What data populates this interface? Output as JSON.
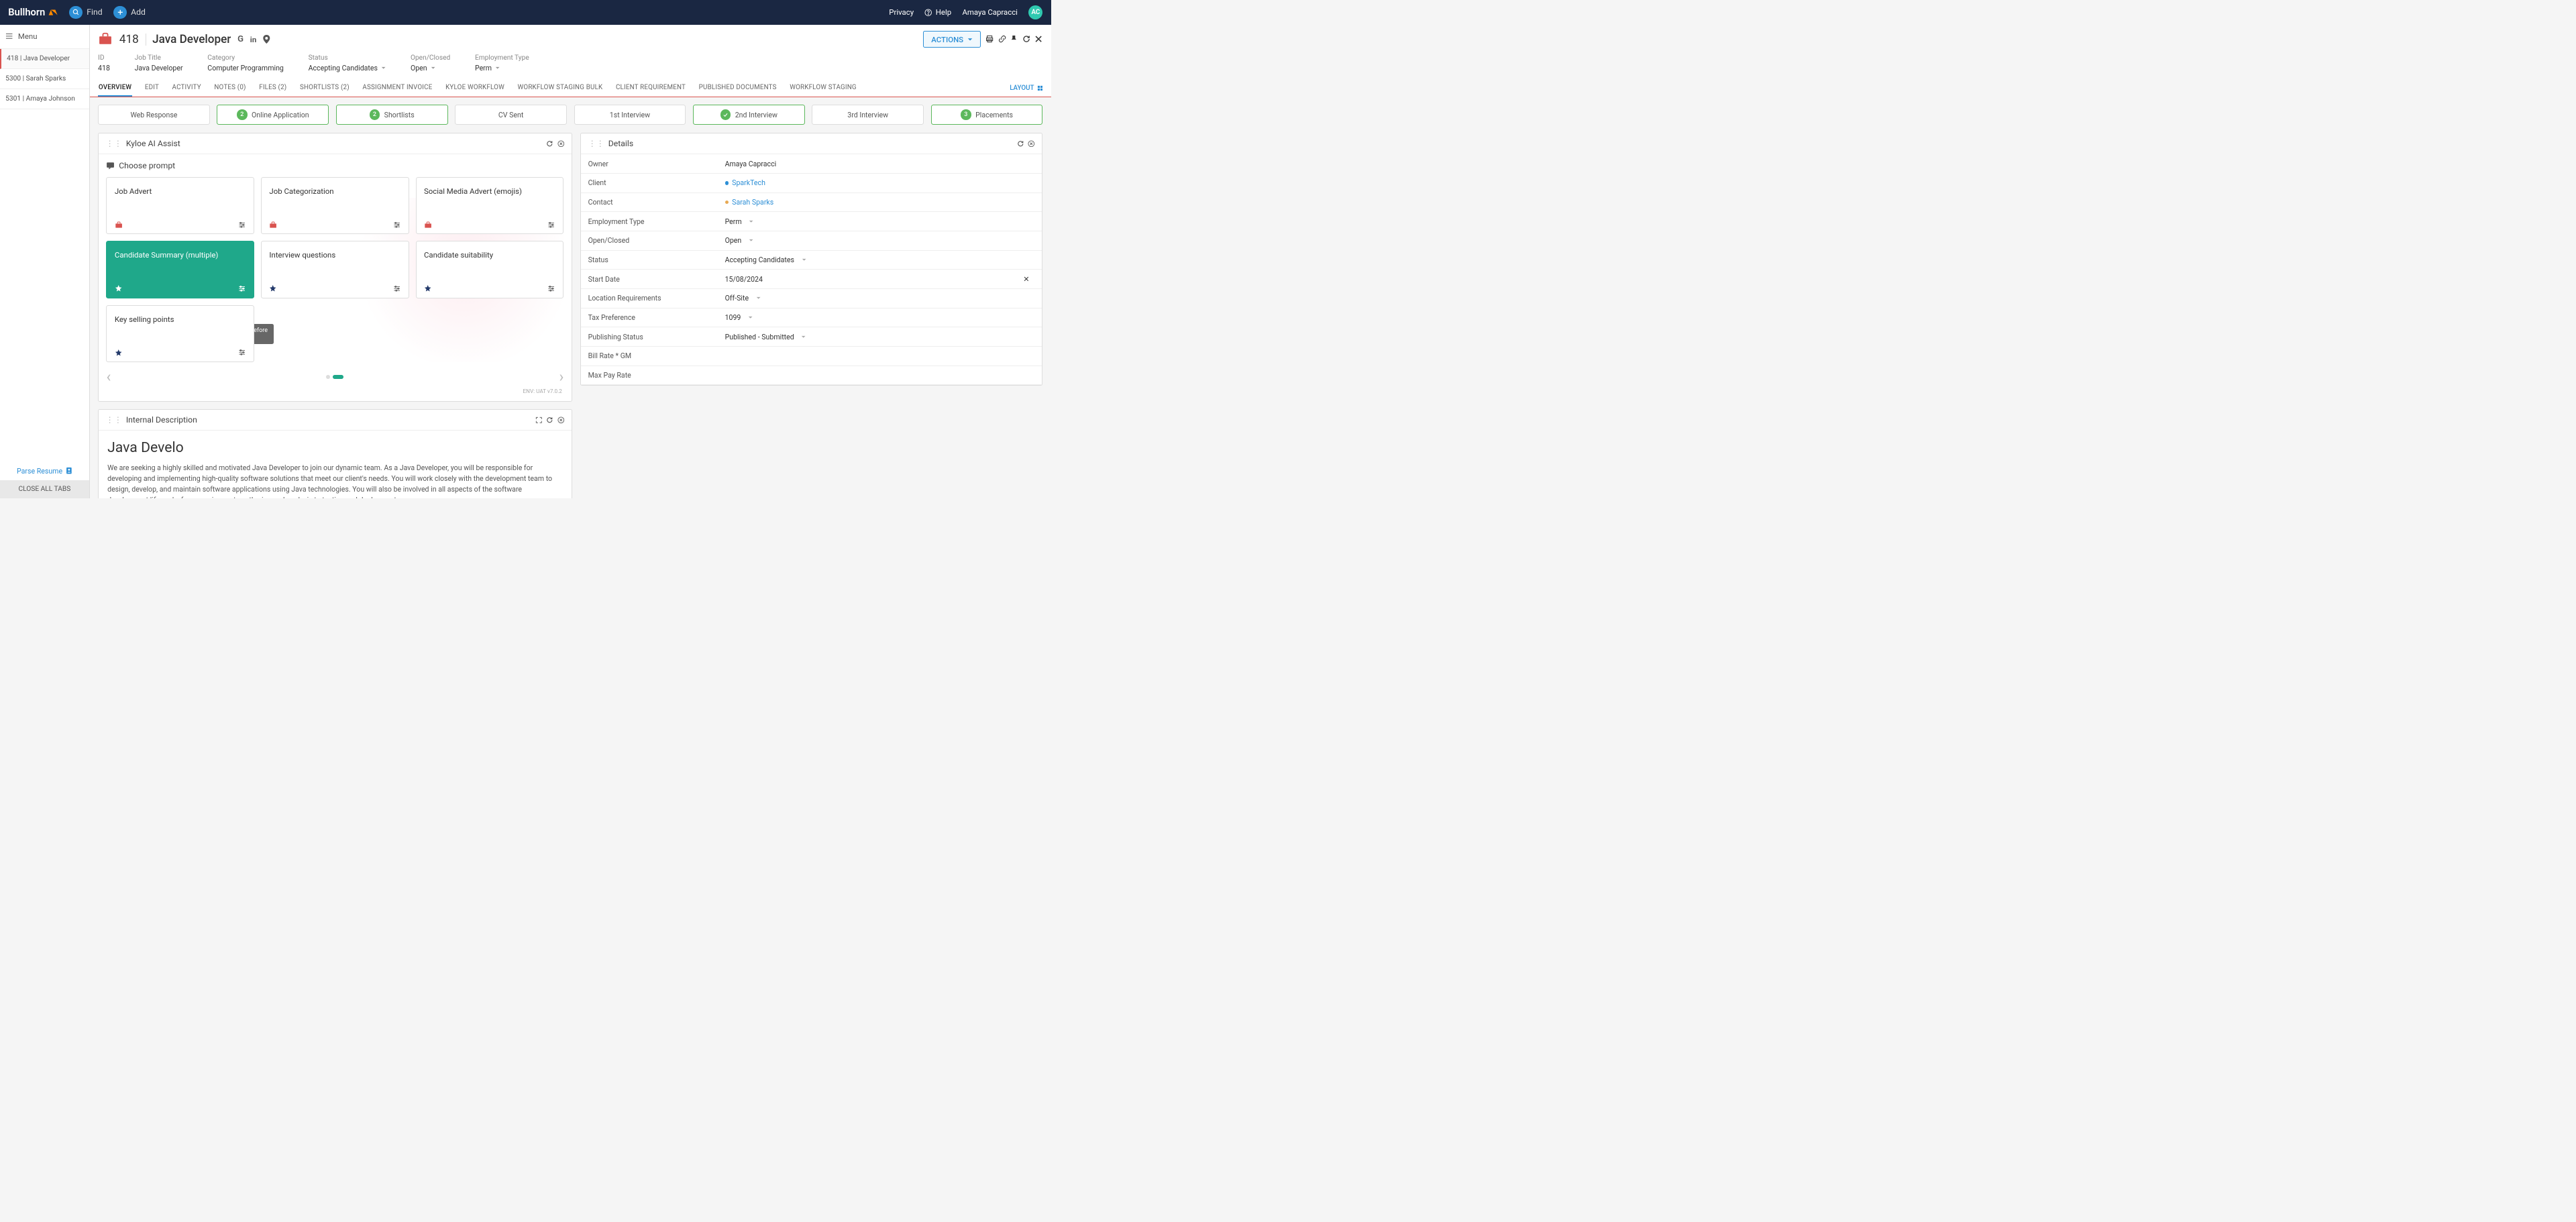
{
  "topnav": {
    "logo": "Bullhorn",
    "find": "Find",
    "add": "Add",
    "privacy": "Privacy",
    "help": "Help",
    "user": "Amaya Capracci",
    "avatar_initials": "AC"
  },
  "sidebar": {
    "menu": "Menu",
    "tabs": [
      {
        "label": "418 | Java Developer",
        "active": true
      },
      {
        "label": "5300 | Sarah Sparks",
        "active": false
      },
      {
        "label": "5301 | Amaya Johnson",
        "active": false
      }
    ],
    "parse": "Parse Resume",
    "close_all": "CLOSE ALL TABS"
  },
  "record": {
    "id": "418",
    "title": "Java Developer",
    "actions_btn": "ACTIONS",
    "fields": [
      {
        "label": "ID",
        "value": "418"
      },
      {
        "label": "Job Title",
        "value": "Java Developer"
      },
      {
        "label": "Category",
        "value": "Computer Programming"
      },
      {
        "label": "Status",
        "value": "Accepting Candidates",
        "dropdown": true
      },
      {
        "label": "Open/Closed",
        "value": "Open",
        "dropdown": true
      },
      {
        "label": "Employment Type",
        "value": "Perm",
        "dropdown": true
      }
    ],
    "tabs": [
      "OVERVIEW",
      "EDIT",
      "ACTIVITY",
      "NOTES (0)",
      "FILES (2)",
      "SHORTLISTS (2)",
      "ASSIGNMENT INVOICE",
      "KYLOE WORKFLOW",
      "WORKFLOW STAGING BULK",
      "CLIENT REQUIREMENT",
      "PUBLISHED DOCUMENTS",
      "WORKFLOW STAGING"
    ],
    "active_tab": "OVERVIEW",
    "layout": "LAYOUT"
  },
  "stages": [
    {
      "label": "Web Response",
      "count": null,
      "style": "plain"
    },
    {
      "label": "Online Application",
      "count": "2",
      "style": "green"
    },
    {
      "label": "Shortlists",
      "count": "2",
      "style": "green"
    },
    {
      "label": "CV Sent",
      "count": null,
      "style": "plain"
    },
    {
      "label": "1st Interview",
      "count": null,
      "style": "plain"
    },
    {
      "label": "2nd Interview",
      "count": null,
      "style": "green-check"
    },
    {
      "label": "3rd Interview",
      "count": null,
      "style": "plain"
    },
    {
      "label": "Placements",
      "count": "3",
      "style": "green"
    }
  ],
  "kyloe": {
    "title": "Kyloe AI Assist",
    "choose_prompt": "Choose prompt",
    "cards": [
      {
        "title": "Job Advert",
        "icon": "briefcase"
      },
      {
        "title": "Job Categorization",
        "icon": "briefcase"
      },
      {
        "title": "Social Media Advert (emojis)",
        "icon": "briefcase"
      },
      {
        "title": "Candidate Summary (multiple)",
        "icon": "star",
        "selected": true
      },
      {
        "title": "Interview questions",
        "icon": "star"
      },
      {
        "title": "Candidate suitability",
        "icon": "star"
      },
      {
        "title": "Key selling points",
        "icon": "star"
      }
    ],
    "tooltip": "Configure prompt before running",
    "env": "ENV: UAT v7.0.2"
  },
  "description": {
    "panel_title": "Internal Description",
    "heading": "Java Develo",
    "body": "We are seeking a highly skilled and motivated Java Developer to join our dynamic team. As a Java Developer, you will be responsible for developing and implementing high-quality software solutions that meet our client's needs. You will work closely with the development team to design, develop, and maintain software applications using Java technologies. You will also be involved in all aspects of the software development life cycle, from requirements gathering and analysis to testing and deployment."
  },
  "details": {
    "title": "Details",
    "rows": [
      {
        "label": "Owner",
        "value": "Amaya Capracci"
      },
      {
        "label": "Client",
        "value": "SparkTech",
        "link": "blue",
        "dot": "blue"
      },
      {
        "label": "Contact",
        "value": "Sarah Sparks",
        "link": "blue",
        "dot": "orange"
      },
      {
        "label": "Employment Type",
        "value": "Perm",
        "dropdown": true
      },
      {
        "label": "Open/Closed",
        "value": "Open",
        "dropdown": true
      },
      {
        "label": "Status",
        "value": "Accepting Candidates",
        "dropdown": true
      },
      {
        "label": "Start Date",
        "value": "15/08/2024",
        "clearable": true
      },
      {
        "label": "Location Requirements",
        "value": "Off-Site",
        "dropdown": true
      },
      {
        "label": "Tax Preference",
        "value": "1099",
        "dropdown": true
      },
      {
        "label": "Publishing Status",
        "value": "Published - Submitted",
        "dropdown": true
      },
      {
        "label": "Bill Rate * GM",
        "value": ""
      },
      {
        "label": "Max Pay Rate",
        "value": ""
      }
    ]
  }
}
